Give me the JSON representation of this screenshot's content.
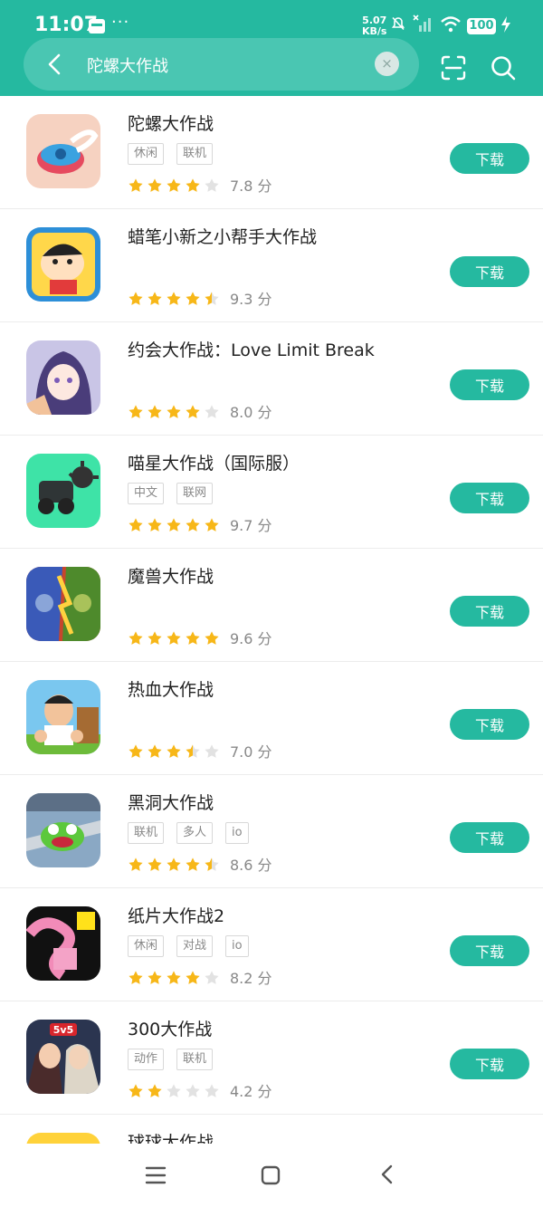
{
  "status_bar": {
    "time": "11:07",
    "more": "···",
    "net_speed_value": "5.07",
    "net_speed_unit": "KB/s",
    "battery": "100"
  },
  "search": {
    "query": "陀螺大作战",
    "clear_symbol": "×"
  },
  "colors": {
    "accent": "#25b9a0",
    "star_filled": "#f7b718",
    "star_empty": "#e2e2e2"
  },
  "apps": [
    {
      "name": "陀螺大作战",
      "tags": [
        "休闲",
        "联机"
      ],
      "rating": 4.0,
      "score": "7.8 分",
      "button": "下载"
    },
    {
      "name": "蜡笔小新之小帮手大作战",
      "tags": [],
      "rating": 4.5,
      "score": "9.3 分",
      "button": "下载"
    },
    {
      "name": "约会大作战：Love Limit Break",
      "tags": [],
      "rating": 4.0,
      "score": "8.0 分",
      "button": "下载"
    },
    {
      "name": "喵星大作战（国际服）",
      "tags": [
        "中文",
        "联网"
      ],
      "rating": 5.0,
      "score": "9.7 分",
      "button": "下载"
    },
    {
      "name": "魔兽大作战",
      "tags": [],
      "rating": 5.0,
      "score": "9.6 分",
      "button": "下载"
    },
    {
      "name": "热血大作战",
      "tags": [],
      "rating": 3.5,
      "score": "7.0 分",
      "button": "下载"
    },
    {
      "name": "黑洞大作战",
      "tags": [
        "联机",
        "多人",
        "io"
      ],
      "rating": 4.5,
      "score": "8.6 分",
      "button": "下载"
    },
    {
      "name": "纸片大作战2",
      "tags": [
        "休闲",
        "对战",
        "io"
      ],
      "rating": 4.0,
      "score": "8.2 分",
      "button": "下载"
    },
    {
      "name": "300大作战",
      "tags": [
        "动作",
        "联机"
      ],
      "rating": 2.0,
      "score": "4.2 分",
      "button": "下载"
    },
    {
      "name": "球球大作战",
      "tags": [],
      "rating": 0,
      "score": "",
      "button": ""
    }
  ],
  "icons": {
    "back": "back-arrow-icon",
    "clear": "clear-icon",
    "scan": "scan-icon",
    "search": "search-icon",
    "nav_menu": "menu-icon",
    "nav_home": "home-icon",
    "nav_back": "nav-back-icon"
  }
}
